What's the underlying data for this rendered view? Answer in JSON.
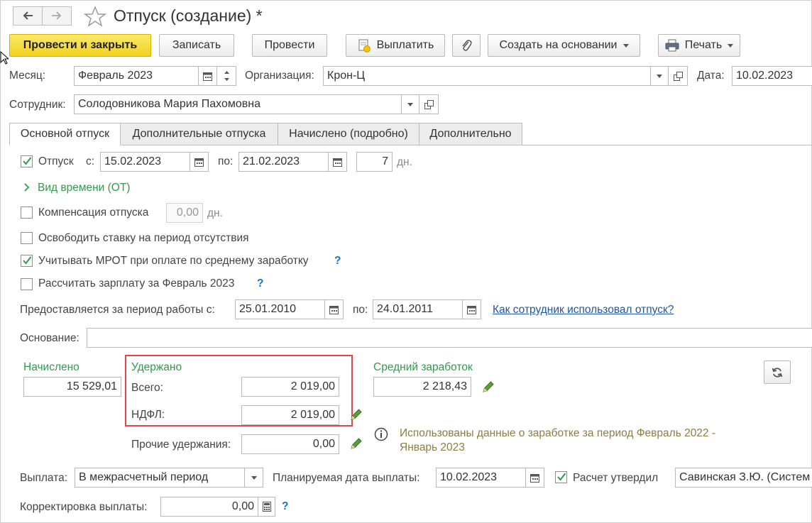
{
  "title": "Отпуск (создание) *",
  "toolbar": {
    "post_close": "Провести и закрыть",
    "save": "Записать",
    "post": "Провести",
    "pay": "Выплатить",
    "create_based": "Создать на основании",
    "print": "Печать"
  },
  "header": {
    "month_label": "Месяц:",
    "month_value": "Февраль 2023",
    "org_label": "Организация:",
    "org_value": "Крон-Ц",
    "date_label": "Дата:",
    "date_value": "10.02.2023",
    "employee_label": "Сотрудник:",
    "employee_value": "Солодовникова Мария Пахомовна"
  },
  "tabs": [
    "Основной отпуск",
    "Дополнительные отпуска",
    "Начислено (подробно)",
    "Дополнительно"
  ],
  "vacation": {
    "label": "Отпуск",
    "from_label": "с:",
    "from_value": "15.02.2023",
    "to_label": "по:",
    "to_value": "21.02.2023",
    "days_value": "7",
    "days_unit": "дн.",
    "time_type": "Вид времени (ОТ)"
  },
  "options": {
    "compensation_label": "Компенсация отпуска",
    "compensation_value": "0,00",
    "compensation_unit": "дн.",
    "free_rate": "Освободить ставку на период отсутствия",
    "mrot": "Учитывать МРОТ при оплате по среднему заработку",
    "calc_salary": "Рассчитать зарплату за Февраль 2023",
    "help": "?"
  },
  "work_period": {
    "label": "Предоставляется за период работы с:",
    "from_value": "25.01.2010",
    "to_label": "по:",
    "to_value": "24.01.2011",
    "link": "Как сотрудник использовал отпуск?"
  },
  "basis": {
    "label": "Основание:",
    "value": ""
  },
  "accrued": {
    "label": "Начислено",
    "value": "15 529,01"
  },
  "withheld": {
    "label": "Удержано",
    "total_label": "Всего:",
    "total_value": "2 019,00",
    "ndfl_label": "НДФЛ:",
    "ndfl_value": "2 019,00",
    "other_label": "Прочие удержания:",
    "other_value": "0,00"
  },
  "average": {
    "label": "Средний заработок",
    "value": "2 218,43",
    "info_line1": "Использованы данные о заработке за период Февраль 2022 -",
    "info_line2": "Январь 2023"
  },
  "payment": {
    "label": "Выплата:",
    "value": "В межрасчетный период",
    "planned_label": "Планируемая дата выплаты:",
    "planned_value": "10.02.2023",
    "approved_label": "Расчет утвердил",
    "approved_value": "Савинская З.Ю. (Систем",
    "correction_label": "Корректировка выплаты:",
    "correction_value": "0,00"
  },
  "colors": {
    "primary_button": "#f2d21d",
    "section_green": "#2f9c4b",
    "highlight_red": "#e0464c",
    "link_blue": "#1f56a6"
  }
}
